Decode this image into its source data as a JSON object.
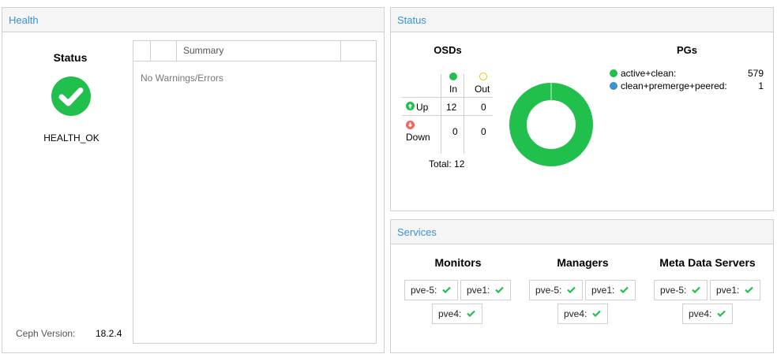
{
  "health": {
    "header": "Health",
    "status_title": "Status",
    "status_text": "HEALTH_OK",
    "ceph_version_label": "Ceph Version:",
    "ceph_version_value": "18.2.4",
    "grid": {
      "summary_header": "Summary",
      "empty_text": "No Warnings/Errors"
    },
    "colors": {
      "ok": "#21bf4b"
    }
  },
  "status": {
    "header": "Status",
    "osds": {
      "title": "OSDs",
      "col_in": "In",
      "col_out": "Out",
      "row_up": "Up",
      "row_down": "Down",
      "up_in": "12",
      "up_out": "0",
      "down_in": "0",
      "down_out": "0",
      "total": "Total: 12"
    },
    "pgs": {
      "title": "PGs",
      "items": [
        {
          "label": "active+clean:",
          "value": "579",
          "color": "#21bf4b"
        },
        {
          "label": "clean+premerge+peered:",
          "value": "1",
          "color": "#3892d4"
        }
      ]
    },
    "donut": {
      "color": "#21bf4b",
      "values": [
        579,
        1
      ]
    }
  },
  "services": {
    "header": "Services",
    "monitors": {
      "title": "Monitors",
      "hosts": [
        "pve-5:",
        "pve1:",
        "pve4:"
      ]
    },
    "managers": {
      "title": "Managers",
      "hosts": [
        "pve-5:",
        "pve1:",
        "pve4:"
      ]
    },
    "mds": {
      "title": "Meta Data Servers",
      "hosts": [
        "pve-5:",
        "pve1:",
        "pve4:"
      ]
    }
  }
}
